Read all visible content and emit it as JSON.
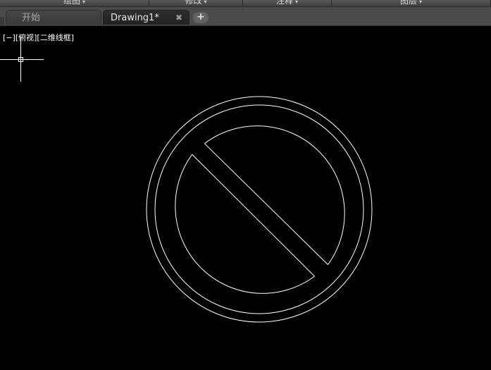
{
  "ribbon": {
    "panels": [
      {
        "label": "绘图",
        "arrow": "▾"
      },
      {
        "label": "修改",
        "arrow": "▾"
      },
      {
        "label": "注释",
        "arrow": "▾"
      },
      {
        "label": "图层",
        "arrow": "▾"
      }
    ]
  },
  "tabs": {
    "start_label": "开始",
    "drawing_label": "Drawing1*",
    "close_glyph": "✖",
    "new_glyph": "+"
  },
  "viewport": {
    "control": "[−]",
    "view": "[俯视]",
    "visual_style": "[二维线框]"
  },
  "colors": {
    "canvas_background": "#000000",
    "geometry_stroke": "#ffffff",
    "tab_bar": "#4b4b4b"
  }
}
